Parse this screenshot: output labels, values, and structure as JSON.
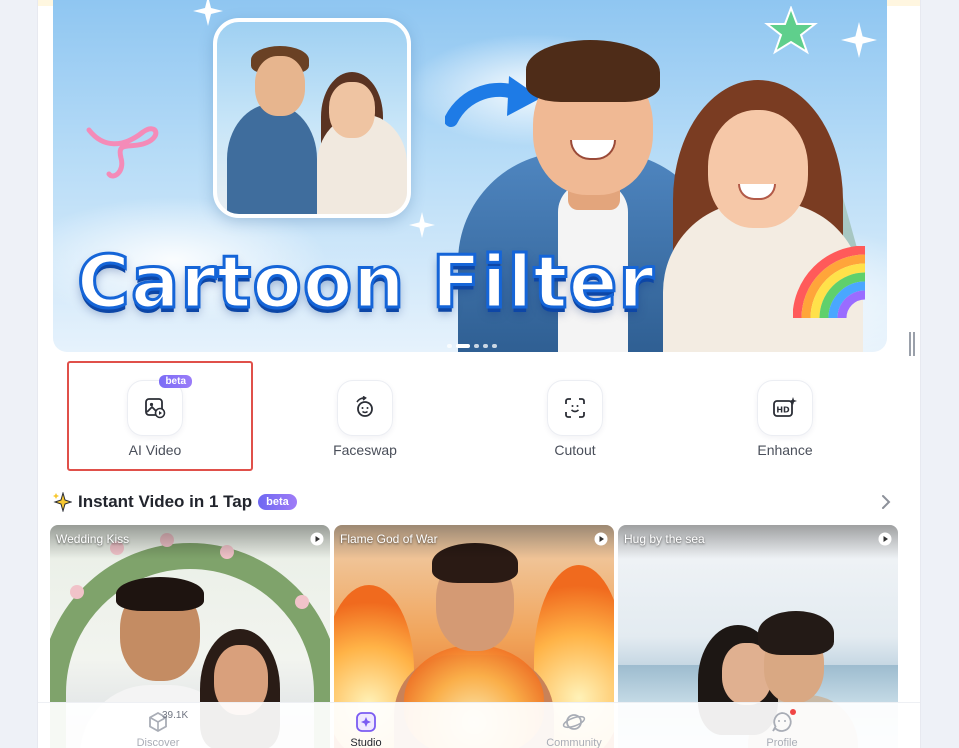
{
  "banner": {
    "title": "Cartoon Filter",
    "carousel": {
      "count": 5,
      "active_index": 1
    }
  },
  "tools": [
    {
      "label": "AI Video",
      "badge": "beta",
      "icon": "image-video-icon"
    },
    {
      "label": "Faceswap",
      "badge": "",
      "icon": "faceswap-icon"
    },
    {
      "label": "Cutout",
      "badge": "",
      "icon": "cutout-icon"
    },
    {
      "label": "Enhance",
      "badge": "",
      "icon": "hd-enhance-icon"
    }
  ],
  "section": {
    "title": "Instant Video in 1 Tap",
    "badge": "beta",
    "icon": "sparkle-icon"
  },
  "cards": [
    {
      "title": "Wedding Kiss"
    },
    {
      "title": "Flame God of War"
    },
    {
      "title": "Hug by the sea"
    }
  ],
  "nav": {
    "items": [
      {
        "label": "Discover",
        "count": "39.1K",
        "icon": "cube-icon",
        "active": false
      },
      {
        "label": "Studio",
        "icon": "studio-icon",
        "active": true
      },
      {
        "label": "Community",
        "icon": "planet-icon",
        "active": false
      },
      {
        "label": "Profile",
        "icon": "profile-icon",
        "active": false,
        "notification": true
      }
    ]
  },
  "colors": {
    "accent": "#7b6cf6",
    "highlight_border": "#e0504a",
    "title_blue": "#1565d8"
  }
}
